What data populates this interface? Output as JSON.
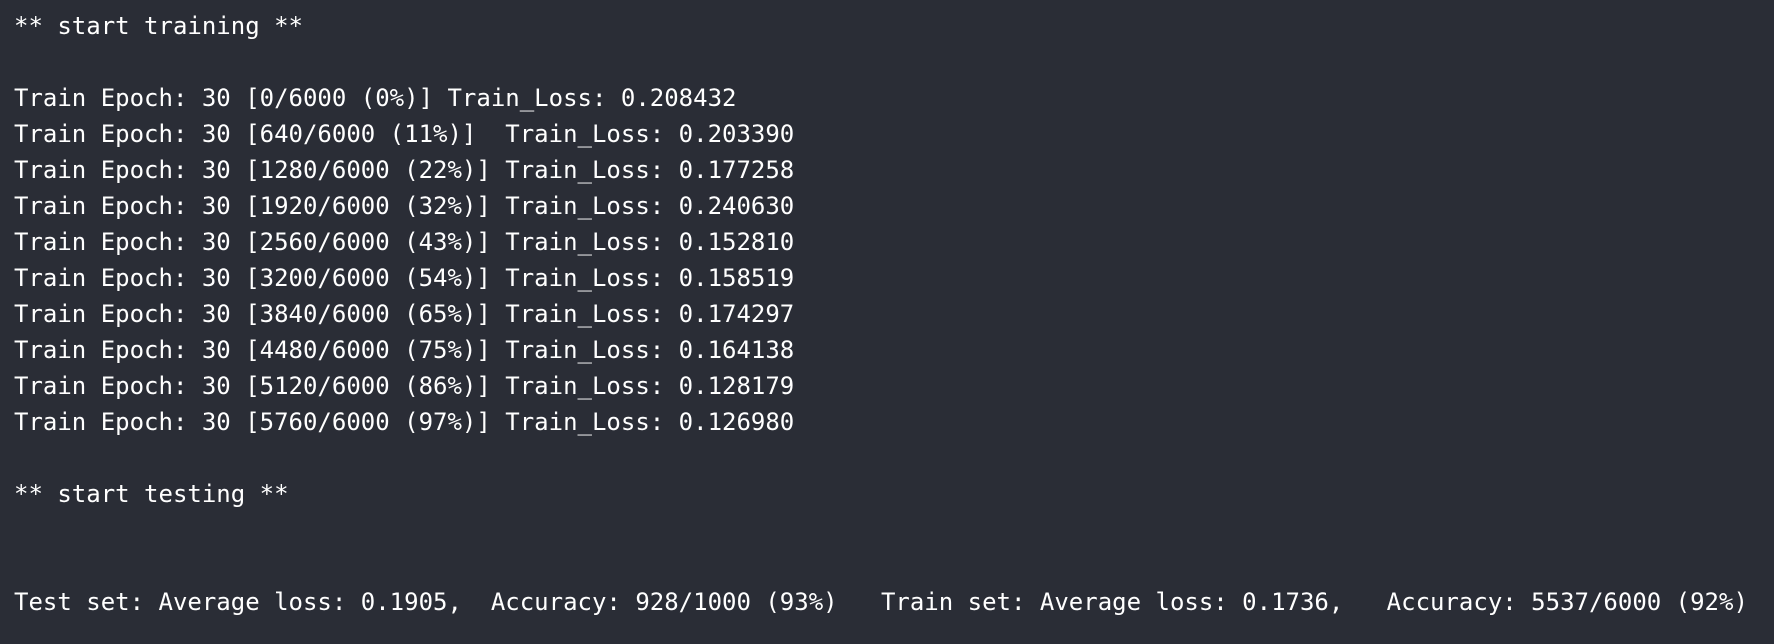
{
  "terminal": {
    "lines": [
      "** start training **",
      "",
      "Train Epoch: 30 [0/6000 (0%)] Train_Loss: 0.208432",
      "Train Epoch: 30 [640/6000 (11%)]  Train_Loss: 0.203390",
      "Train Epoch: 30 [1280/6000 (22%)] Train_Loss: 0.177258",
      "Train Epoch: 30 [1920/6000 (32%)] Train_Loss: 0.240630",
      "Train Epoch: 30 [2560/6000 (43%)] Train_Loss: 0.152810",
      "Train Epoch: 30 [3200/6000 (54%)] Train_Loss: 0.158519",
      "Train Epoch: 30 [3840/6000 (65%)] Train_Loss: 0.174297",
      "Train Epoch: 30 [4480/6000 (75%)] Train_Loss: 0.164138",
      "Train Epoch: 30 [5120/6000 (86%)] Train_Loss: 0.128179",
      "Train Epoch: 30 [5760/6000 (97%)] Train_Loss: 0.126980",
      "",
      "** start testing **",
      "",
      "",
      "Test set: Average loss: 0.1905,  Accuracy: 928/1000 (93%)   Train set: Average loss: 0.1736,   Accuracy: 5537/6000 (92%)"
    ]
  },
  "colors": {
    "background": "#2a2d36",
    "text": "#ffffff"
  }
}
